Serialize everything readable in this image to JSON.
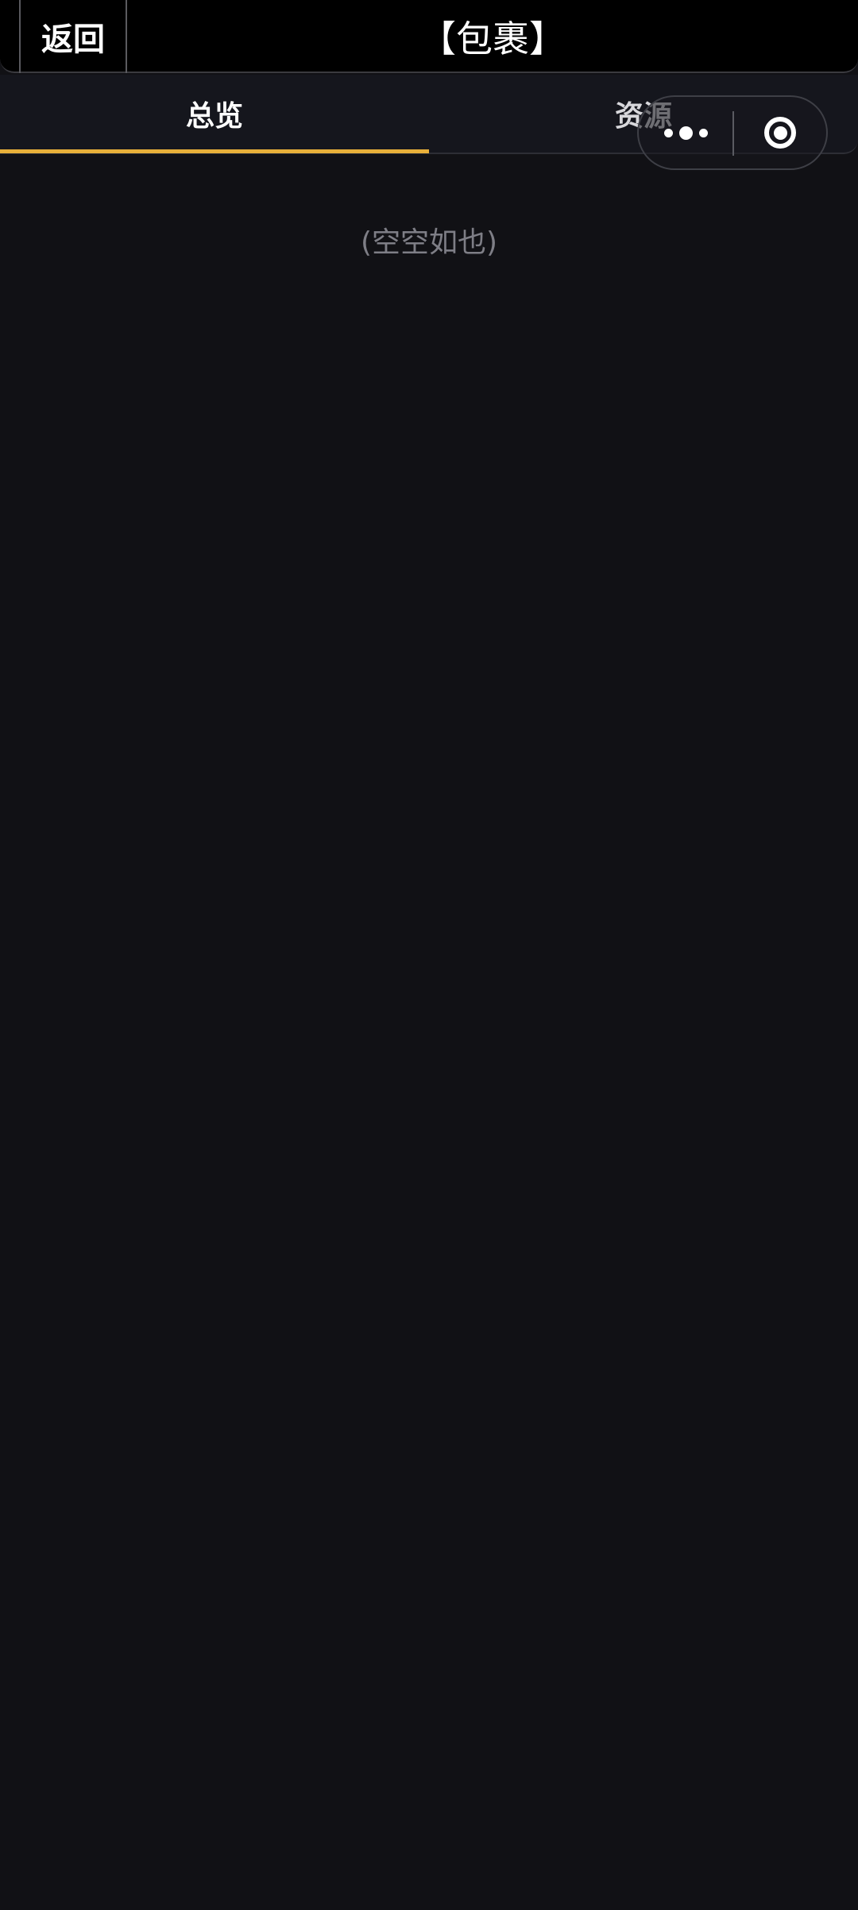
{
  "header": {
    "back_label": "返回",
    "title": "【包裹】"
  },
  "tabs": [
    {
      "label": "总览",
      "active": true
    },
    {
      "label": "资源",
      "active": false
    }
  ],
  "empty_state": {
    "text": "(空空如也)"
  },
  "capsule": {
    "more_icon": "more-dots-icon",
    "close_icon": "target-circle-icon"
  },
  "colors": {
    "background": "#111115",
    "header_background": "#000000",
    "tabbar_background": "#15161d",
    "accent": "#e8b03a",
    "muted_text": "#7e7e86"
  }
}
